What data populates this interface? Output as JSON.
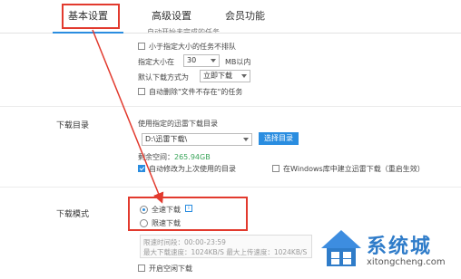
{
  "tabs": [
    "基本设置",
    "高级设置",
    "会员功能"
  ],
  "task_section": {
    "partial_top": "自动开始未完成的任务",
    "skip_small_label": "小于指定大小的任务不排队",
    "size_prefix": "指定大小在",
    "size_value": "30",
    "size_unit": "MB以内",
    "default_mode_label": "默认下载方式为",
    "default_mode_value": "立即下载",
    "auto_delete_label": "自动删除\"文件不存在\"的任务"
  },
  "dir_section": {
    "title": "下载目录",
    "use_dir_label": "使用指定的迅雷下载目录",
    "path_value": "D:\\迅雷下载\\",
    "choose_button": "选择目录",
    "space_label": "剩余空间：",
    "space_value": "265.94GB",
    "auto_modify_label": "自动修改为上次使用的目录",
    "create_dir_label": "在Windows库中建立迅雷下载（重启生效）"
  },
  "mode_section": {
    "title": "下载模式",
    "full_speed": "全速下载",
    "limited_speed": "限速下载",
    "time_range": "限速时间段：00:00-23:59",
    "max_speeds": "最大下载速度：1024KB/S  最大上传速度：1024KB/S",
    "idle_download": "开启空闲下载"
  },
  "watermark": {
    "name": "系统城",
    "url": "xitongcheng.com"
  },
  "colors": {
    "accent": "#2a8de0",
    "highlight": "#e23a2e"
  }
}
